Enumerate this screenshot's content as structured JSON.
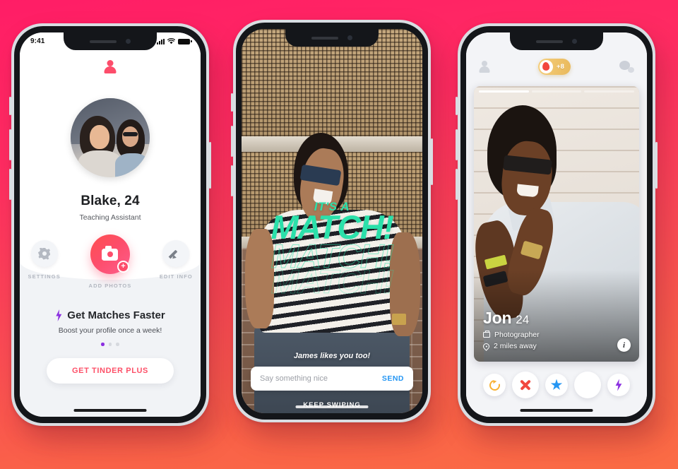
{
  "background": {
    "top_color": "#FF1D66",
    "bottom_color": "#FB6C45"
  },
  "phone1": {
    "name": "profile-screen",
    "status_bar": {
      "time": "9:41",
      "signal": "signal-bars",
      "wifi": "wifi",
      "battery": "battery-full"
    },
    "nav": {
      "profile_icon": "person-icon",
      "flame_icon": "flame-icon"
    },
    "profile": {
      "name": "Blake, 24",
      "occupation": "Teaching Assistant"
    },
    "actions": [
      {
        "label": "SETTINGS",
        "icon": "gear-icon"
      },
      {
        "label": "ADD PHOTOS",
        "icon": "camera-plus-icon"
      },
      {
        "label": "EDIT INFO",
        "icon": "pencil-icon"
      }
    ],
    "promo": {
      "icon": "bolt-icon",
      "title": "Get Matches Faster",
      "subtitle": "Boost your profile once a week!",
      "dots": 3,
      "active_dot": 0,
      "button_label": "GET TINDER PLUS",
      "button_color": "#FD5068",
      "accent_color": "#8B2FE0"
    }
  },
  "phone2": {
    "name": "its-a-match-screen",
    "match": {
      "line1": "IT'S A",
      "line2": "MATCH!",
      "color": "#2BE0AA",
      "heart_icon": "heart-icon",
      "caption": "James likes you too!"
    },
    "message": {
      "placeholder": "Say something nice",
      "value": "",
      "send_label": "SEND",
      "send_color": "#2596F3"
    },
    "keep_swiping_label": "KEEP SWIPING"
  },
  "phone3": {
    "name": "discover-screen",
    "header": {
      "profile_icon": "person-icon",
      "chat_icon": "chat-bubble-icon",
      "boost_badge": {
        "icon": "flame-icon",
        "count": "+8",
        "color": "#E9B95C"
      }
    },
    "card": {
      "photo_segments": 3,
      "active_segment": 0,
      "name": "Jon",
      "age": "24",
      "occupation": "Photographer",
      "occupation_icon": "briefcase-icon",
      "distance": "2 miles away",
      "distance_icon": "location-pin-icon",
      "info_button": "i"
    },
    "action_buttons": [
      {
        "name": "rewind-button",
        "icon": "rewind-icon",
        "color": "#F8B133"
      },
      {
        "name": "nope-button",
        "icon": "x-icon",
        "color": "#F1473E"
      },
      {
        "name": "super-like-button",
        "icon": "star-icon",
        "color": "#2596F3"
      },
      {
        "name": "like-button",
        "icon": "heart-icon",
        "color": "#2BE0AA"
      },
      {
        "name": "boost-button",
        "icon": "bolt-icon",
        "color": "#8B2FE0"
      }
    ]
  }
}
